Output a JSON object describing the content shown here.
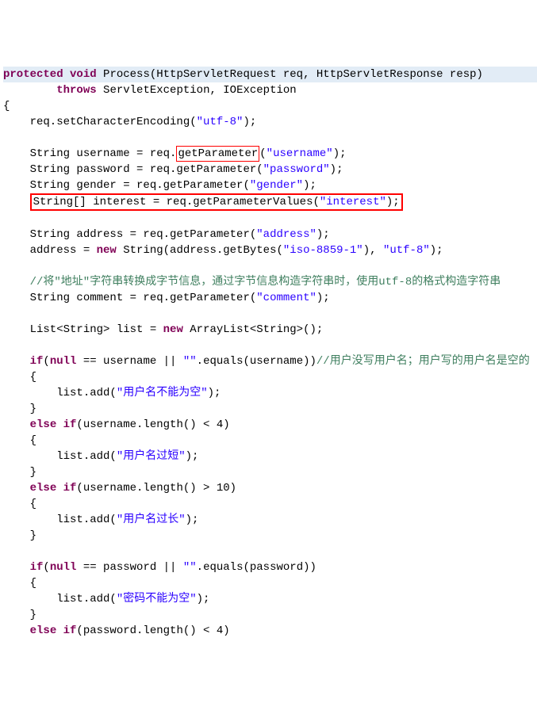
{
  "code": {
    "kw_protected": "protected",
    "kw_void": "void",
    "kw_throws": "throws",
    "kw_new": "new",
    "kw_if": "if",
    "kw_else_if": "else if",
    "kw_null": "null",
    "sig_method": " Process(HttpServletRequest req, HttpServletResponse resp)",
    "sig_throws_rest": " ServletException, IOException",
    "open_brace": "{",
    "close_brace": "}",
    "enc_call_pre": "    req.setCharacterEncoding(",
    "enc_str": "\"utf-8\"",
    "enc_call_post": ");",
    "l_user_pre": "    String username = req.",
    "l_user_box": "getParameter",
    "l_user_post1": "(",
    "l_user_str": "\"username\"",
    "l_user_post2": ");",
    "l_pass_pre": "    String password = req.getParameter(",
    "l_pass_str": "\"password\"",
    "l_pass_post": ");",
    "l_gender_pre": "    String gender = req.getParameter(",
    "l_gender_str": "\"gender\"",
    "l_gender_post": ");",
    "l_interest_gap": "    ",
    "l_interest_pre": "String[] interest = req.getParameterValues(",
    "l_interest_str": "\"interest\"",
    "l_interest_post": ");",
    "l_addr_pre": "    String address = req.getParameter(",
    "l_addr_str": "\"address\"",
    "l_addr_post": ");",
    "l_addr2_pre": "    address = ",
    "l_addr2_mid": " String(address.getBytes(",
    "l_addr2_str1": "\"iso-8859-1\"",
    "l_addr2_mid2": "), ",
    "l_addr2_str2": "\"utf-8\"",
    "l_addr2_post": ");",
    "comment_cn": "    //将\"地址\"字符串转换成字节信息，通过字节信息构造字符串时，使用utf-8的格式构造字符串",
    "l_comment_pre": "    String comment = req.getParameter(",
    "l_comment_str": "\"comment\"",
    "l_comment_post": ");",
    "l_list_pre": "    List<String> list = ",
    "l_list_post": " ArrayList<String>();",
    "if1_pre": "    ",
    "if1_cond_a": "(",
    "if1_cond_b": " == username || ",
    "if1_cond_empty": "\"\"",
    "if1_cond_c": ".equals(username))",
    "if1_comment": "//用户没写用户名；用户写的用户名是空的",
    "brace_open_indent": "    {",
    "brace_close_indent": "    }",
    "add1_pre": "        list.add(",
    "add1_str": "\"用户名不能为空\"",
    "add1_post": ");",
    "elif1_cond": "(username.length() < 4)",
    "add2_str": "\"用户名过短\"",
    "elif2_cond": "(username.length() > 10)",
    "add3_str": "\"用户名过长\"",
    "if2_cond_a": "(",
    "if2_cond_b": " == password || ",
    "if2_cond_c": ".equals(password))",
    "add4_str": "\"密码不能为空\"",
    "elif3_cond": "(password.length() < 4)"
  }
}
